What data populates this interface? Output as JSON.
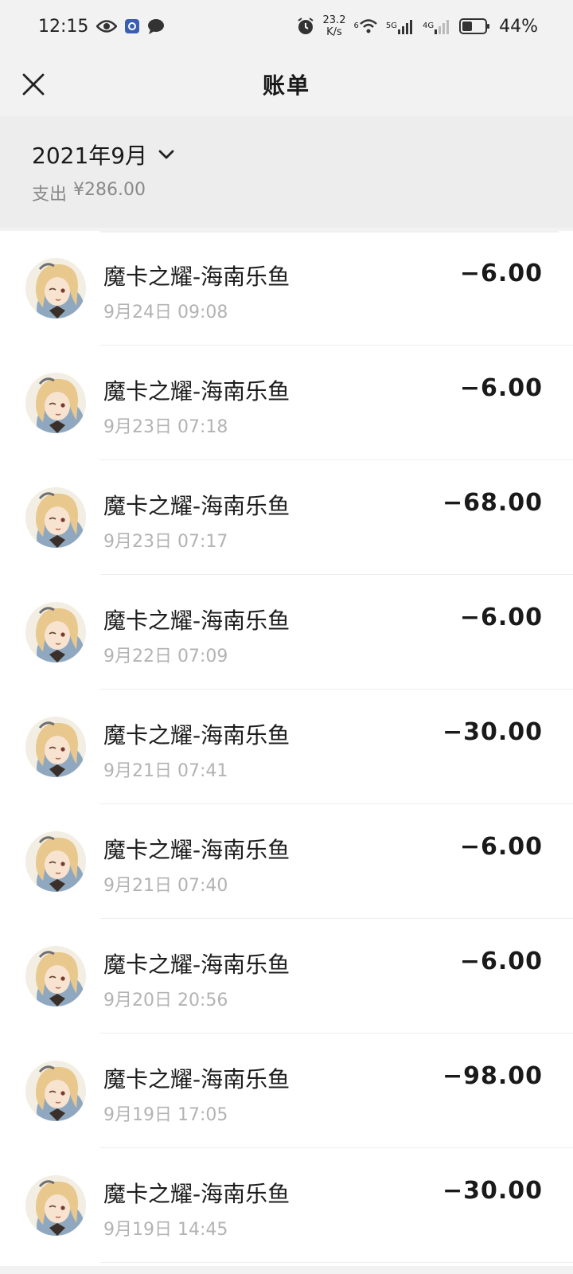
{
  "status_bar": {
    "time": "12:15",
    "net_speed_value": "23.2",
    "net_speed_unit": "K/s",
    "wifi_tag": "6",
    "sim1_tag": "5G",
    "sim2_tag": "4G",
    "battery": "44%",
    "battery_level": 0.44,
    "icons": [
      "eye-icon",
      "app-icon",
      "chat-icon",
      "alarm-icon",
      "wifi-icon",
      "signal-icon",
      "battery-icon"
    ]
  },
  "nav": {
    "title": "账单",
    "close_icon": "close-icon"
  },
  "summary": {
    "month": "2021年9月",
    "expense_label": "支出",
    "expense_value": "¥286.00"
  },
  "transactions": [
    {
      "name": "魔卡之耀-海南乐鱼",
      "time": "9月24日 09:08",
      "amount": "−6.00"
    },
    {
      "name": "魔卡之耀-海南乐鱼",
      "time": "9月23日 07:18",
      "amount": "−6.00"
    },
    {
      "name": "魔卡之耀-海南乐鱼",
      "time": "9月23日 07:17",
      "amount": "−68.00"
    },
    {
      "name": "魔卡之耀-海南乐鱼",
      "time": "9月22日 07:09",
      "amount": "−6.00"
    },
    {
      "name": "魔卡之耀-海南乐鱼",
      "time": "9月21日 07:41",
      "amount": "−30.00"
    },
    {
      "name": "魔卡之耀-海南乐鱼",
      "time": "9月21日 07:40",
      "amount": "−6.00"
    },
    {
      "name": "魔卡之耀-海南乐鱼",
      "time": "9月20日 20:56",
      "amount": "−6.00"
    },
    {
      "name": "魔卡之耀-海南乐鱼",
      "time": "9月19日 17:05",
      "amount": "−98.00"
    },
    {
      "name": "魔卡之耀-海南乐鱼",
      "time": "9月19日 14:45",
      "amount": "−30.00"
    }
  ],
  "colors": {
    "background": "#f2f2f2",
    "list_bg": "#ffffff",
    "secondary_text": "#b3b3b3"
  }
}
